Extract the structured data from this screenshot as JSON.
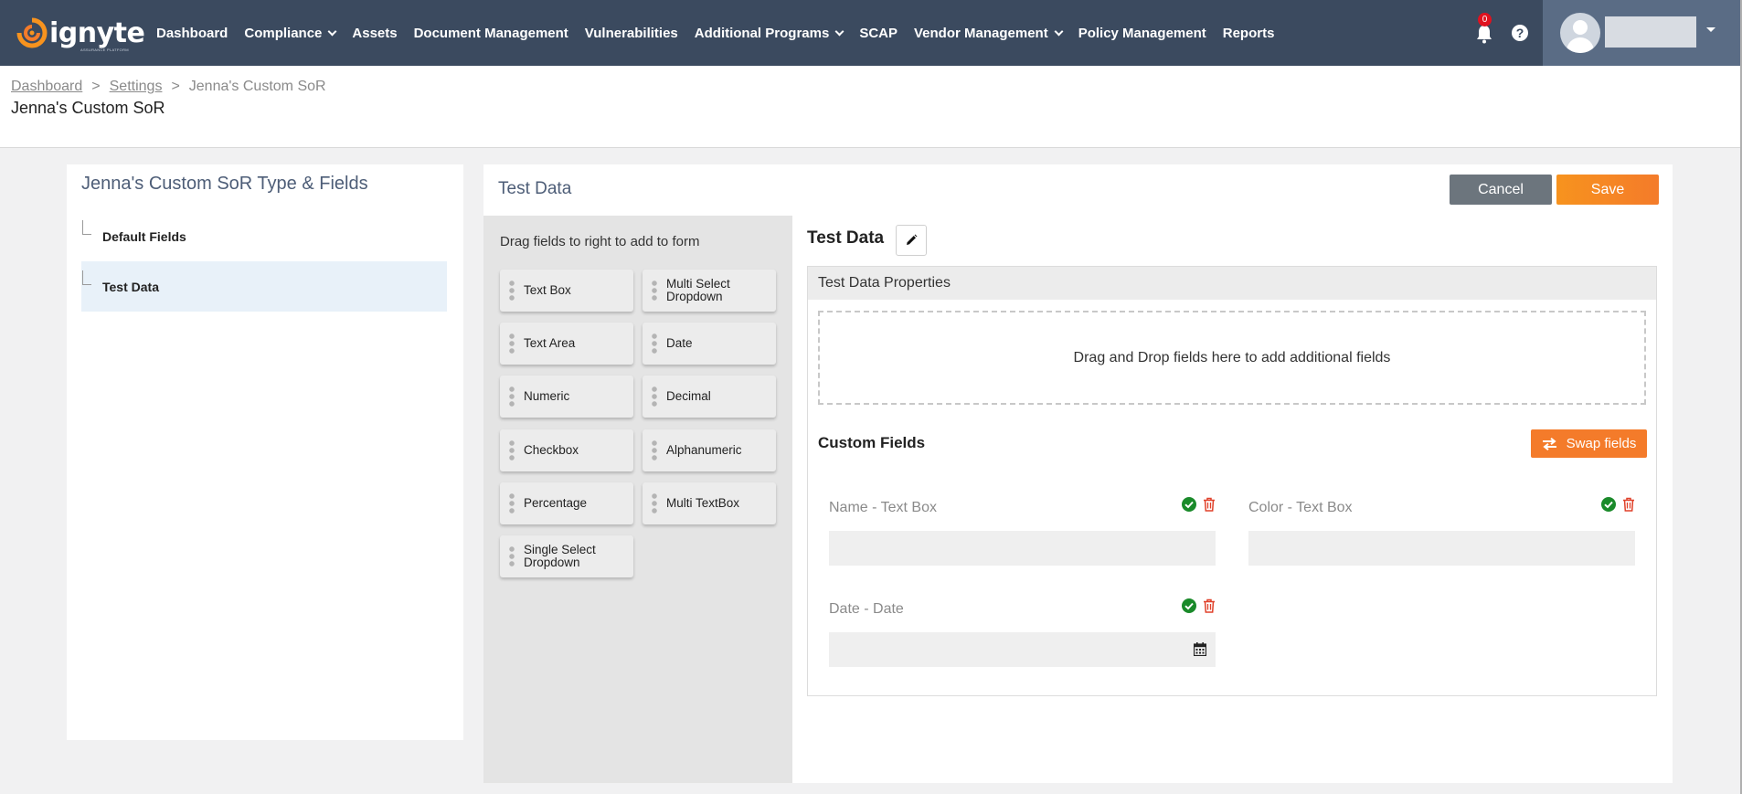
{
  "nav": {
    "brand": "ignyte",
    "brand_tagline": "ASSURANCE PLATFORM",
    "items": [
      {
        "label": "Dashboard",
        "dropdown": false
      },
      {
        "label": "Compliance",
        "dropdown": true
      },
      {
        "label": "Assets",
        "dropdown": false
      },
      {
        "label": "Document Management",
        "dropdown": false
      },
      {
        "label": "Vulnerabilities",
        "dropdown": false
      },
      {
        "label": "Additional Programs",
        "dropdown": true
      },
      {
        "label": "SCAP",
        "dropdown": false
      },
      {
        "label": "Vendor Management",
        "dropdown": true
      },
      {
        "label": "Policy Management",
        "dropdown": false
      },
      {
        "label": "Reports",
        "dropdown": false
      }
    ],
    "notification_count": "0",
    "help_glyph": "?"
  },
  "breadcrumb": {
    "items": [
      "Dashboard",
      "Settings",
      "Jenna's Custom SoR"
    ],
    "separator": ">"
  },
  "page_title": "Jenna's Custom SoR",
  "left_panel": {
    "title": "Jenna's Custom SoR Type & Fields",
    "items": [
      {
        "label": "Default Fields",
        "active": false
      },
      {
        "label": "Test Data",
        "active": true
      }
    ]
  },
  "right_panel": {
    "title": "Test Data",
    "cancel_label": "Cancel",
    "save_label": "Save",
    "palette": {
      "hint": "Drag fields to right to add to form",
      "fields": [
        "Text Box",
        "Multi Select Dropdown",
        "Text Area",
        "Date",
        "Numeric",
        "Decimal",
        "Checkbox",
        "Alphanumeric",
        "Percentage",
        "Multi TextBox",
        "Single Select Dropdown"
      ]
    },
    "form": {
      "section_name": "Test Data",
      "properties_header": "Test Data Properties",
      "dropzone_text": "Drag and Drop fields here to add additional fields",
      "custom_fields_title": "Custom Fields",
      "swap_label": "Swap fields",
      "fields": [
        {
          "label": "Name - Text Box",
          "type": "text"
        },
        {
          "label": "Color - Text Box",
          "type": "text"
        },
        {
          "label": "Date - Date",
          "type": "date"
        }
      ]
    }
  },
  "colors": {
    "nav_bg": "#3b4a5f",
    "accent_orange": "#f47b2a",
    "cancel_gray": "#6c757d",
    "active_item_bg": "#e8f1f9",
    "check_green": "#1a8a2a",
    "trash_red": "#e0412a"
  }
}
